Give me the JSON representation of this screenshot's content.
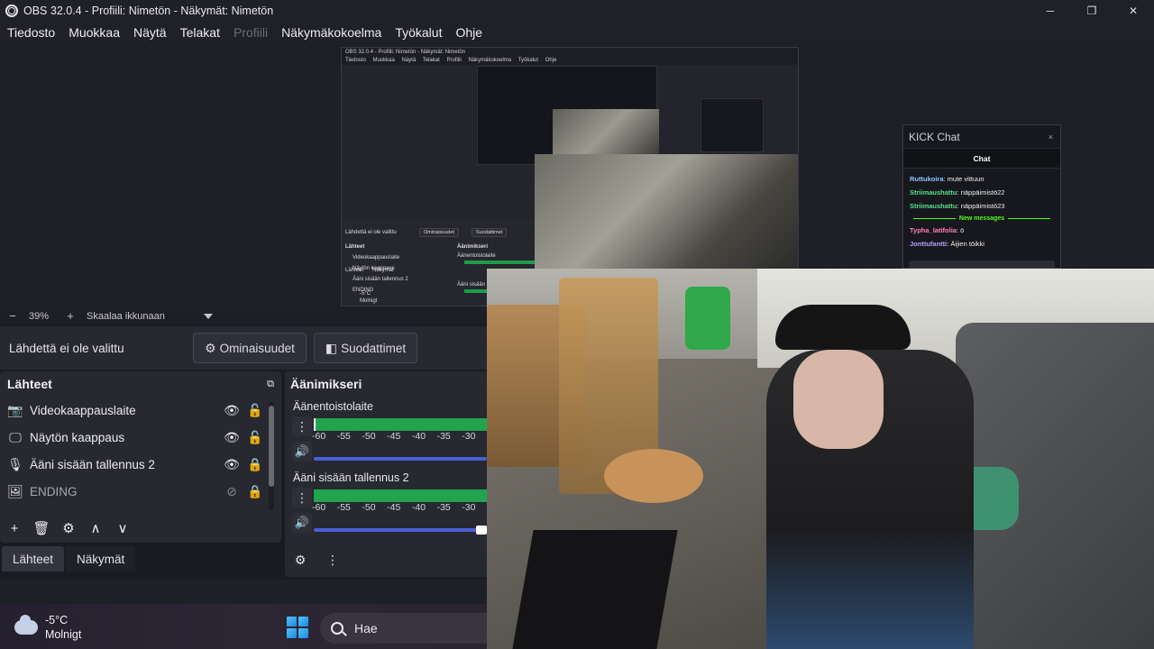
{
  "window": {
    "title": "OBS 32.0.4 - Profiili: Nimetön - Näkymät: Nimetön",
    "minimize": "─",
    "maximize": "❐",
    "close": "✕"
  },
  "menu": [
    "Tiedosto",
    "Muokkaa",
    "Näytä",
    "Telakat",
    "Profiili",
    "Näkymäkokoelma",
    "Työkalut",
    "Ohje"
  ],
  "nested": {
    "title": "OBS 32.0.4 - Profiili: Nimetön - Näkymät: Nimetön",
    "menu": [
      "Tiedosto",
      "Muokkaa",
      "Näytä",
      "Telakat",
      "Profiili",
      "Näkymäkokoelma",
      "Työkalut",
      "Ohje"
    ],
    "no_source": "Lähdettä ei ole valittu",
    "props": "Ominaisuudet",
    "filters": "Suodattimet",
    "sources_title": "Lähteet",
    "mixer_title": "Äänimikseri",
    "sources": [
      "Videokaappauslaite",
      "Näytön kaappaus",
      "Ääni sisään tallennus 2",
      "ENDING"
    ],
    "ch1": "Äänentoistolaite",
    "ch2": "Ääni sisään tallennus 2",
    "tab1": "Lähteet",
    "tab2": "Näkymät",
    "temp": "-5°C",
    "weather": "Molnigt"
  },
  "kick": {
    "window_title": "KICK Chat",
    "close": "×",
    "chat_title": "Chat",
    "messages": [
      {
        "user": "Ruttukoira",
        "text": "mute vittuun"
      },
      {
        "user": "Striimaushattu",
        "text": "näppäimistö22"
      },
      {
        "user": "Striimaushattu",
        "text": "näppäimistö23"
      },
      {
        "user": "Typha_latifolia",
        "text": "ö"
      },
      {
        "user": "Jonttufantti",
        "text": "Äijien töikki"
      }
    ],
    "new_messages": "New messages"
  },
  "zoom": {
    "minus": "−",
    "value": "39%",
    "plus": "+",
    "scale_mode": "Skaalaa ikkunaan"
  },
  "context": {
    "no_source": "Lähdettä ei ole valittu",
    "properties": "Ominaisuudet",
    "filters": "Suodattimet"
  },
  "sources": {
    "title": "Lähteet",
    "items": [
      {
        "name": "Videokaappauslaite",
        "icon": "camera-icon",
        "visible": true,
        "locked": false
      },
      {
        "name": "Näytön kaappaus",
        "icon": "monitor-icon",
        "visible": true,
        "locked": false
      },
      {
        "name": "Ääni sisään tallennus 2",
        "icon": "microphone-icon",
        "visible": true,
        "locked": true
      },
      {
        "name": "ENDING",
        "icon": "image-icon",
        "visible": false,
        "locked": true
      }
    ]
  },
  "tabs": {
    "sources": "Lähteet",
    "scenes": "Näkymät"
  },
  "mixer": {
    "title": "Äänimikseri",
    "channels": [
      {
        "name": "Äänentoistolaite",
        "level": 1.0
      },
      {
        "name": "Ääni sisään tallennus 2",
        "level": 1.0
      }
    ],
    "ticks": [
      "-60",
      "-55",
      "-50",
      "-45",
      "-40",
      "-35",
      "-30"
    ]
  },
  "taskbar": {
    "temperature": "-5°C",
    "weather": "Molnigt",
    "search": "Hae"
  },
  "colors": {
    "accent": "#4a5fd6",
    "meter_green": "#22a34e",
    "kick_green": "#53fc18"
  }
}
